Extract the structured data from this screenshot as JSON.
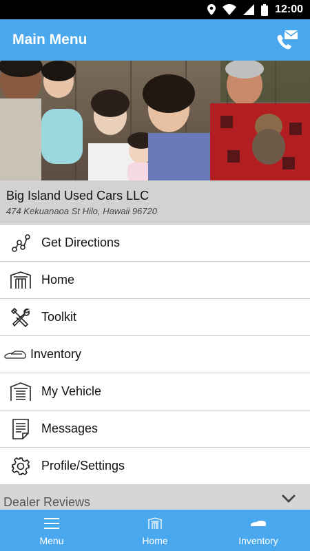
{
  "status_bar": {
    "time": "12:00"
  },
  "app_bar": {
    "title": "Main Menu",
    "contact_icon": "phone-mail-icon"
  },
  "hero": {
    "icon": "family-photo"
  },
  "dealer": {
    "name": "Big Island Used Cars LLC",
    "address": "474 Kekuanaoa St  Hilo, Hawaii 96720"
  },
  "menu": {
    "items": [
      {
        "label": "Get Directions",
        "icon": "directions-icon"
      },
      {
        "label": "Home",
        "icon": "home-garage-icon"
      },
      {
        "label": "Toolkit",
        "icon": "tools-icon"
      },
      {
        "label": "Inventory",
        "icon": "car-icon"
      },
      {
        "label": "My Vehicle",
        "icon": "garage-car-icon"
      },
      {
        "label": "Messages",
        "icon": "document-icon"
      },
      {
        "label": "Profile/Settings",
        "icon": "gear-icon"
      }
    ]
  },
  "reviews": {
    "label": "Dealer Reviews",
    "icon": "chevron-down-icon"
  },
  "bottom_nav": {
    "items": [
      {
        "label": "Menu",
        "icon": "hamburger-icon"
      },
      {
        "label": "Home",
        "icon": "home-garage-icon"
      },
      {
        "label": "Inventory",
        "icon": "car-icon"
      }
    ]
  },
  "colors": {
    "primary": "#4aa8ee",
    "status_bar": "#000000",
    "dealer_bg": "#d2d2d2"
  }
}
